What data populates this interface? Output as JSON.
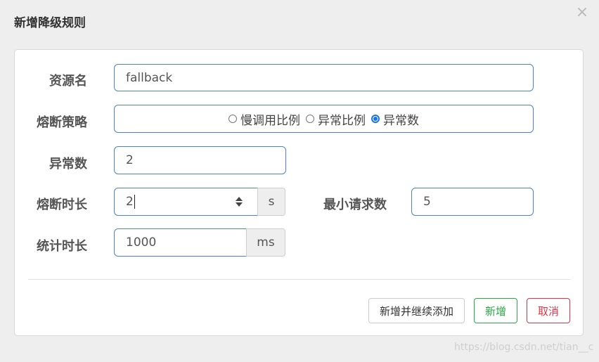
{
  "dialog": {
    "title": "新增降级规则",
    "close_label": "×"
  },
  "form": {
    "resource_label": "资源名",
    "resource_value": "fallback",
    "strategy_label": "熔断策略",
    "strategy_options": [
      {
        "label": "慢调用比例",
        "selected": false
      },
      {
        "label": "异常比例",
        "selected": false
      },
      {
        "label": "异常数",
        "selected": true
      }
    ],
    "exception_count_label": "异常数",
    "exception_count_value": "2",
    "duration_label": "熔断时长",
    "duration_value": "2",
    "duration_unit": "s",
    "min_request_label": "最小请求数",
    "min_request_value": "5",
    "stat_label": "统计时长",
    "stat_value": "1000",
    "stat_unit": "ms"
  },
  "footer": {
    "add_continue_label": "新增并继续添加",
    "add_label": "新增",
    "cancel_label": "取消"
  },
  "colors": {
    "accent": "#1a73e8",
    "input_border": "#4a83c6",
    "success": "#28a745",
    "danger": "#dc3545"
  },
  "watermark": "https://blog.csdn.net/tian__c"
}
